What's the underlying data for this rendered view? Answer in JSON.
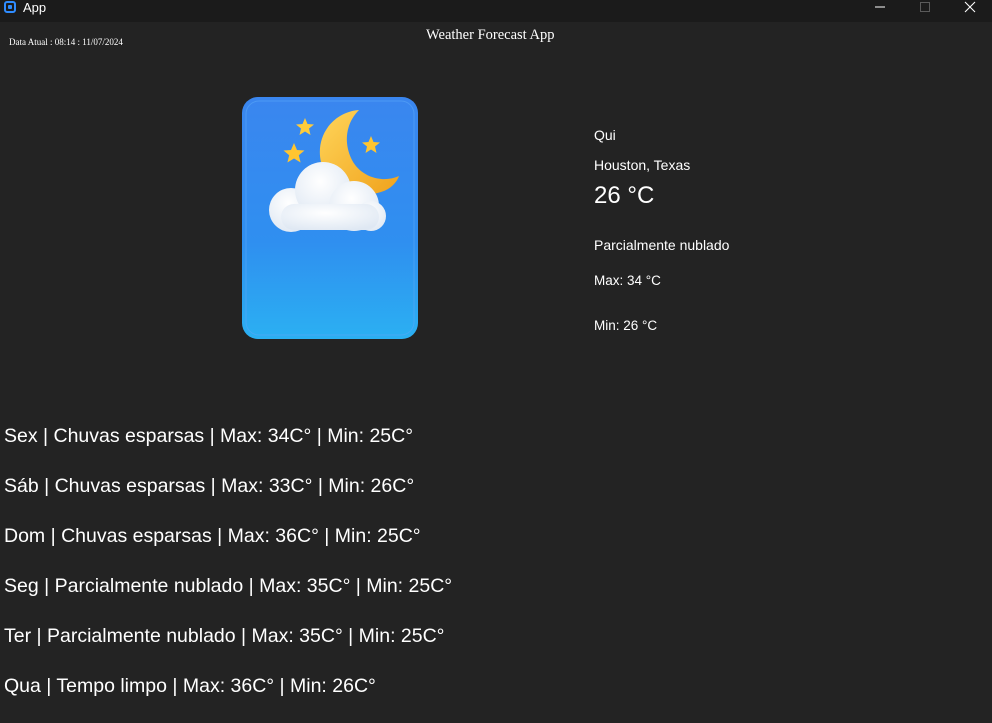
{
  "window": {
    "title": "App"
  },
  "header": {
    "date_label": "Data Atual : 08:14 : 11/07/2024",
    "app_title": "Weather Forecast App"
  },
  "current": {
    "icon": "moon-cloud-stars-icon",
    "day": "Qui",
    "location": "Houston, Texas",
    "temperature": "26 °C",
    "condition": "Parcialmente nublado",
    "max": "Max: 34 °C",
    "min": "Min: 26 °C"
  },
  "forecast": [
    "Sex | Chuvas esparsas | Max: 34C° | Min: 25C°",
    "Sáb | Chuvas esparsas | Max: 33C° | Min: 26C°",
    "Dom | Chuvas esparsas | Max: 36C° | Min: 25C°",
    "Seg | Parcialmente nublado | Max: 35C° | Min: 25C°",
    "Ter | Parcialmente nublado | Max: 35C° | Min: 25C°",
    "Qua | Tempo limpo | Max: 36C° | Min: 26C°"
  ],
  "colors": {
    "background": "#232323",
    "titlebar": "#1b1b1b",
    "card_blue": "#2d8cf0",
    "moon": "#f5b52e",
    "accent": "#2f8cff"
  }
}
